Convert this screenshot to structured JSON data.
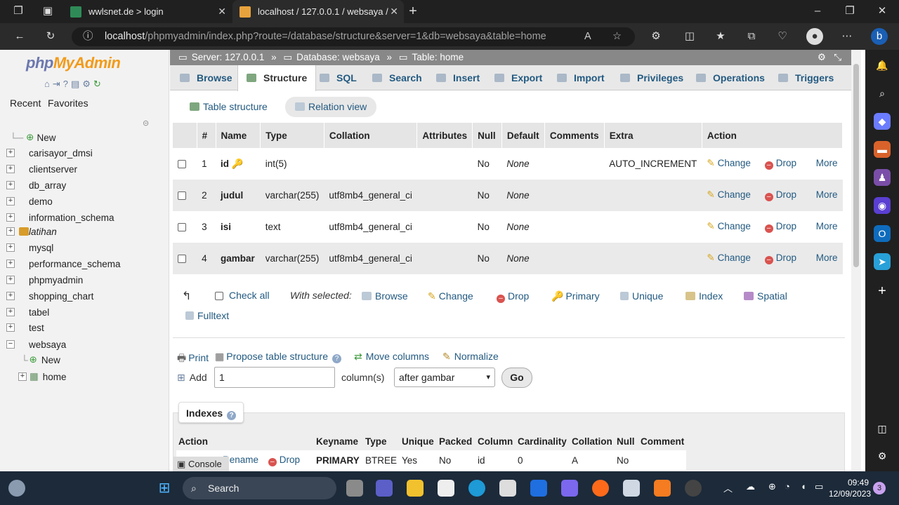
{
  "browser": {
    "tabs": [
      {
        "title": "wwlsnet.de > login",
        "active": false
      },
      {
        "title": "localhost / 127.0.0.1 / websaya /",
        "active": true
      }
    ],
    "url_host": "localhost",
    "url_path": "/phpmyadmin/index.php?route=/database/structure&server=1&db=websaya&table=home"
  },
  "nav": {
    "logo_a": "php",
    "logo_b": "MyAdmin",
    "recent": "Recent",
    "favorites": "Favorites",
    "new_label": "New",
    "databases": [
      "carisayor_dmsi",
      "clientserver",
      "db_array",
      "demo",
      "information_schema",
      "latihan",
      "mysql",
      "performance_schema",
      "phpmyadmin",
      "shopping_chart",
      "tabel",
      "test",
      "websaya"
    ],
    "websaya_new": "New",
    "websaya_table": "home"
  },
  "breadcrumb": {
    "server": "Server: 127.0.0.1",
    "database": "Database: websaya",
    "table": "Table: home"
  },
  "tabs": [
    "Browse",
    "Structure",
    "SQL",
    "Search",
    "Insert",
    "Export",
    "Import",
    "Privileges",
    "Operations",
    "Triggers"
  ],
  "subtabs": {
    "table_structure": "Table structure",
    "relation_view": "Relation view"
  },
  "columns_header": [
    "#",
    "Name",
    "Type",
    "Collation",
    "Attributes",
    "Null",
    "Default",
    "Comments",
    "Extra",
    "Action"
  ],
  "rows": [
    {
      "num": "1",
      "name": "id",
      "type": "int(5)",
      "collation": "",
      "attributes": "",
      "null": "No",
      "default": "None",
      "comments": "",
      "extra": "AUTO_INCREMENT"
    },
    {
      "num": "2",
      "name": "judul",
      "type": "varchar(255)",
      "collation": "utf8mb4_general_ci",
      "attributes": "",
      "null": "No",
      "default": "None",
      "comments": "",
      "extra": ""
    },
    {
      "num": "3",
      "name": "isi",
      "type": "text",
      "collation": "utf8mb4_general_ci",
      "attributes": "",
      "null": "No",
      "default": "None",
      "comments": "",
      "extra": ""
    },
    {
      "num": "4",
      "name": "gambar",
      "type": "varchar(255)",
      "collation": "utf8mb4_general_ci",
      "attributes": "",
      "null": "No",
      "default": "None",
      "comments": "",
      "extra": ""
    }
  ],
  "row_actions": {
    "change": "Change",
    "drop": "Drop",
    "more": "More"
  },
  "with_selected": {
    "check_all": "Check all",
    "label": "With selected:",
    "browse": "Browse",
    "change": "Change",
    "drop": "Drop",
    "primary": "Primary",
    "unique": "Unique",
    "index": "Index",
    "spatial": "Spatial",
    "fulltext": "Fulltext"
  },
  "tools": {
    "print": "Print",
    "propose": "Propose table structure",
    "move_columns": "Move columns",
    "normalize": "Normalize"
  },
  "add_columns": {
    "label": "Add",
    "value": "1",
    "columns_label": "column(s)",
    "position": "after gambar",
    "go": "Go"
  },
  "indexes": {
    "title": "Indexes",
    "header": [
      "Action",
      "Keyname",
      "Type",
      "Unique",
      "Packed",
      "Column",
      "Cardinality",
      "Collation",
      "Null",
      "Comment"
    ],
    "row": {
      "rename": "Rename",
      "drop": "Drop",
      "keyname": "PRIMARY",
      "type": "BTREE",
      "unique": "Yes",
      "packed": "No",
      "column": "id",
      "cardinality": "0",
      "collation": "A",
      "null": "No",
      "comment": ""
    }
  },
  "console": "Console",
  "taskbar": {
    "search": "Search",
    "time": "09:49",
    "date": "12/09/2023",
    "badge": "3"
  },
  "colors": {
    "link": "#235a81",
    "logo_php": "#6c78af",
    "logo_admin": "#f29b1a",
    "taskbar": "#1c2a3a"
  }
}
